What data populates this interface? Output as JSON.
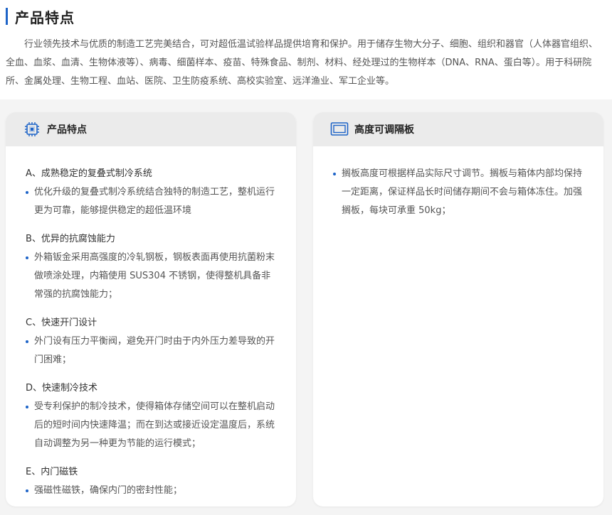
{
  "page": {
    "title": "产品特点",
    "intro": "行业领先技术与优质的制造工艺完美结合，可对超低温试验样品提供培育和保护。用于储存生物大分子、细胞、组织和器官（人体器官组织、全血、血浆、血清、生物体液等）、病毒、细菌样本、疫苗、特殊食品、制剂、材料、经处理过的生物样本（DNA、RNA、蛋白等）。用于科研院所、金属处理、生物工程、血站、医院、卫生防疫系统、高校实验室、远洋渔业、军工企业等。"
  },
  "features_card": {
    "icon": "chip-icon",
    "title": "产品特点",
    "items": [
      {
        "heading": "A、成熟稳定的复叠式制冷系统",
        "detail": "优化升级的复叠式制冷系统结合独特的制造工艺，整机运行更为可靠，能够提供稳定的超低温环境"
      },
      {
        "heading": "B、优异的抗腐蚀能力",
        "detail": "外箱钣金采用高强度的冷轧钢板，钢板表面再使用抗菌粉末做喷涂处理，内箱使用 SUS304 不锈钢，使得整机具备非常强的抗腐蚀能力；"
      },
      {
        "heading": "C、快速开门设计",
        "detail": "外门设有压力平衡阀，避免开门时由于内外压力差导致的开门困难；"
      },
      {
        "heading": "D、快速制冷技术",
        "detail": "受专利保护的制冷技术，使得箱体存储空间可以在整机启动后的短时间内快速降温；而在到达或接近设定温度后，系统自动调整为另一种更为节能的运行模式；"
      },
      {
        "heading": "E、内门磁铁",
        "detail": "强磁性磁铁，确保内门的密封性能；"
      }
    ]
  },
  "shelf_card": {
    "icon": "monitor-icon",
    "title": "高度可调隔板",
    "detail": "搁板高度可根据样品实际尺寸调节。搁板与箱体内部均保持一定距离，保证样品长时间储存期间不会与箱体冻住。加强搁板，每块可承重 50kg；"
  },
  "colors": {
    "accent": "#1e64c8",
    "card_header": "#ebebeb",
    "panel_bg": "#f4f4f4"
  }
}
